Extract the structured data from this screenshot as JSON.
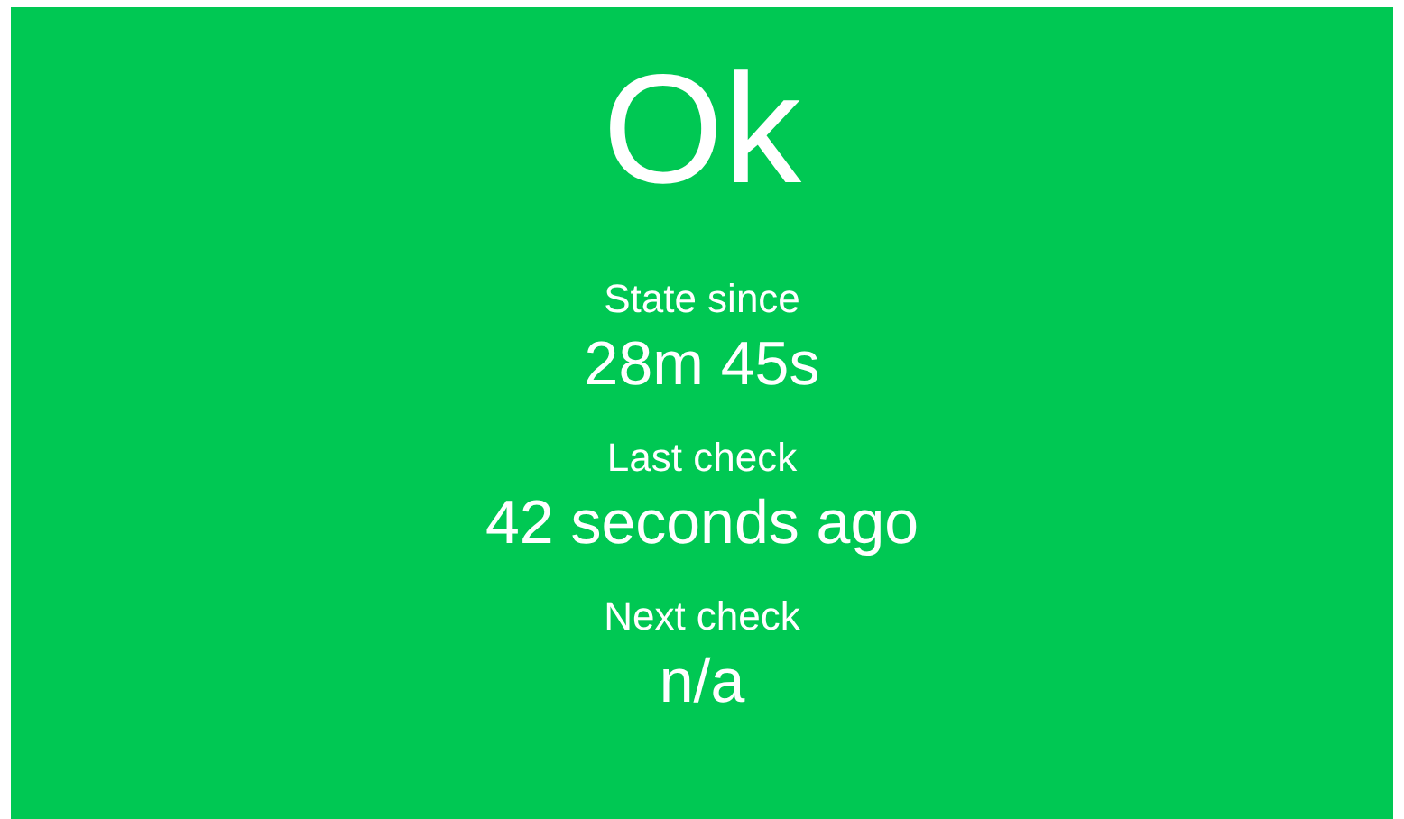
{
  "status": {
    "text": "Ok",
    "kind": "ok"
  },
  "fields": [
    {
      "label": "State since",
      "value": "28m 45s"
    },
    {
      "label": "Last check",
      "value": "42 seconds ago"
    },
    {
      "label": "Next check",
      "value": "n/a"
    }
  ]
}
